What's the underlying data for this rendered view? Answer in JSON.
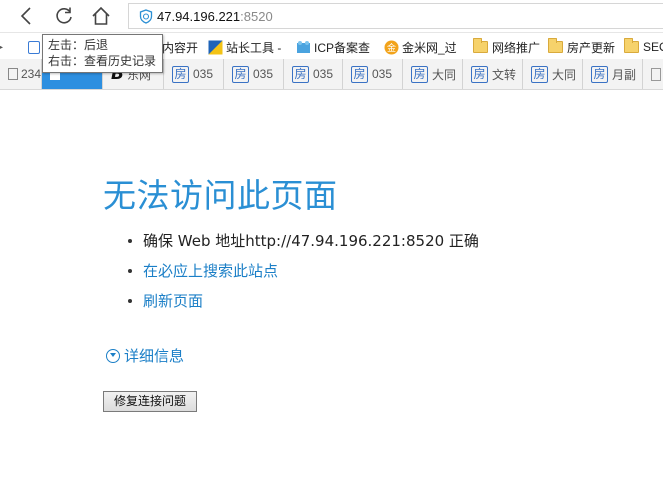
{
  "nav": {
    "back_icon": "chevron-left-icon",
    "refresh_icon": "refresh-icon",
    "home_icon": "home-icon",
    "address": {
      "host": "47.94.196.221",
      "port": ":8520"
    }
  },
  "favorites": [
    {
      "label": "内容开",
      "icon": "page-icon"
    },
    {
      "label": "站长工具 -",
      "icon": "site-tools-icon"
    },
    {
      "label": "ICP备案查",
      "icon": "icp-icon"
    },
    {
      "label": "金米网_过",
      "icon": "coin-icon"
    },
    {
      "label": "网络推广",
      "icon": "folder-icon"
    },
    {
      "label": "房产更新",
      "icon": "folder-icon"
    },
    {
      "label": "SEO",
      "icon": "folder-icon"
    }
  ],
  "tooltip": {
    "line1": "左击：后退",
    "line2": "右击：查看历史记录"
  },
  "tabs": [
    {
      "label": "234",
      "icon": "page-icon"
    },
    {
      "label": "",
      "icon": "page-icon",
      "active": true
    },
    {
      "label": "东网",
      "icon": "bold-b-icon"
    },
    {
      "label": "035",
      "icon": "fang-icon"
    },
    {
      "label": "035",
      "icon": "fang-icon"
    },
    {
      "label": "035",
      "icon": "fang-icon"
    },
    {
      "label": "035",
      "icon": "fang-icon"
    },
    {
      "label": "大同",
      "icon": "fang-icon"
    },
    {
      "label": "文转",
      "icon": "fang-icon"
    },
    {
      "label": "大同",
      "icon": "fang-icon"
    },
    {
      "label": "月副",
      "icon": "fang-icon"
    }
  ],
  "tab_fang_glyph": "房",
  "error": {
    "title": "无法访问此页面",
    "bullets": [
      "确保 Web 地址http://47.94.196.221:8520 正确",
      "在必应上搜索此站点",
      "刷新页面"
    ],
    "details": "详细信息",
    "fix_button": "修复连接问题"
  },
  "colors": {
    "title": "#2a8fd4",
    "link": "#1b7fc7",
    "active_tab": "#2d8fe0"
  }
}
